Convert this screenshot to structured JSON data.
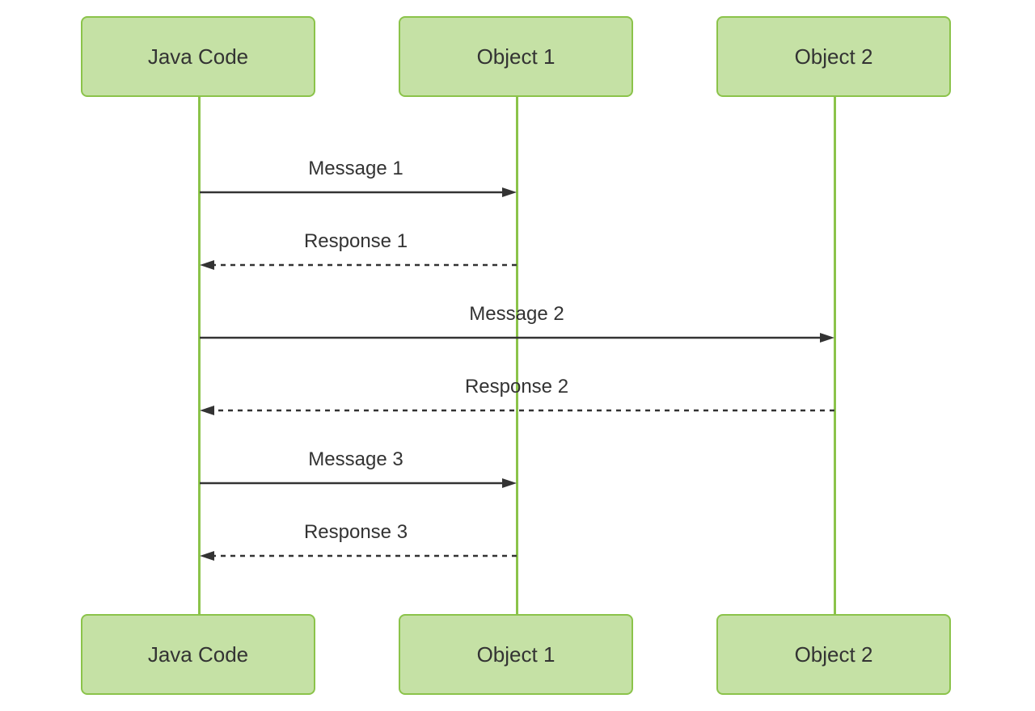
{
  "chart_data": {
    "type": "sequence-diagram",
    "participants": [
      "Java Code",
      "Object 1",
      "Object 2"
    ],
    "messages": [
      {
        "from": "Java Code",
        "to": "Object 1",
        "label": "Message 1",
        "style": "solid"
      },
      {
        "from": "Object 1",
        "to": "Java Code",
        "label": "Response 1",
        "style": "dashed"
      },
      {
        "from": "Java Code",
        "to": "Object 2",
        "label": "Message 2",
        "style": "solid"
      },
      {
        "from": "Object 2",
        "to": "Java Code",
        "label": "Response 2",
        "style": "dashed"
      },
      {
        "from": "Java Code",
        "to": "Object 1",
        "label": "Message 3",
        "style": "solid"
      },
      {
        "from": "Object 1",
        "to": "Java Code",
        "label": "Response 3",
        "style": "dashed"
      }
    ]
  },
  "p0": "Java Code",
  "p1": "Object 1",
  "p2": "Object 2",
  "m1": "Message 1",
  "r1": "Response 1",
  "m2": "Message 2",
  "r2": "Response 2",
  "m3": "Message 3",
  "r3": "Response 3"
}
